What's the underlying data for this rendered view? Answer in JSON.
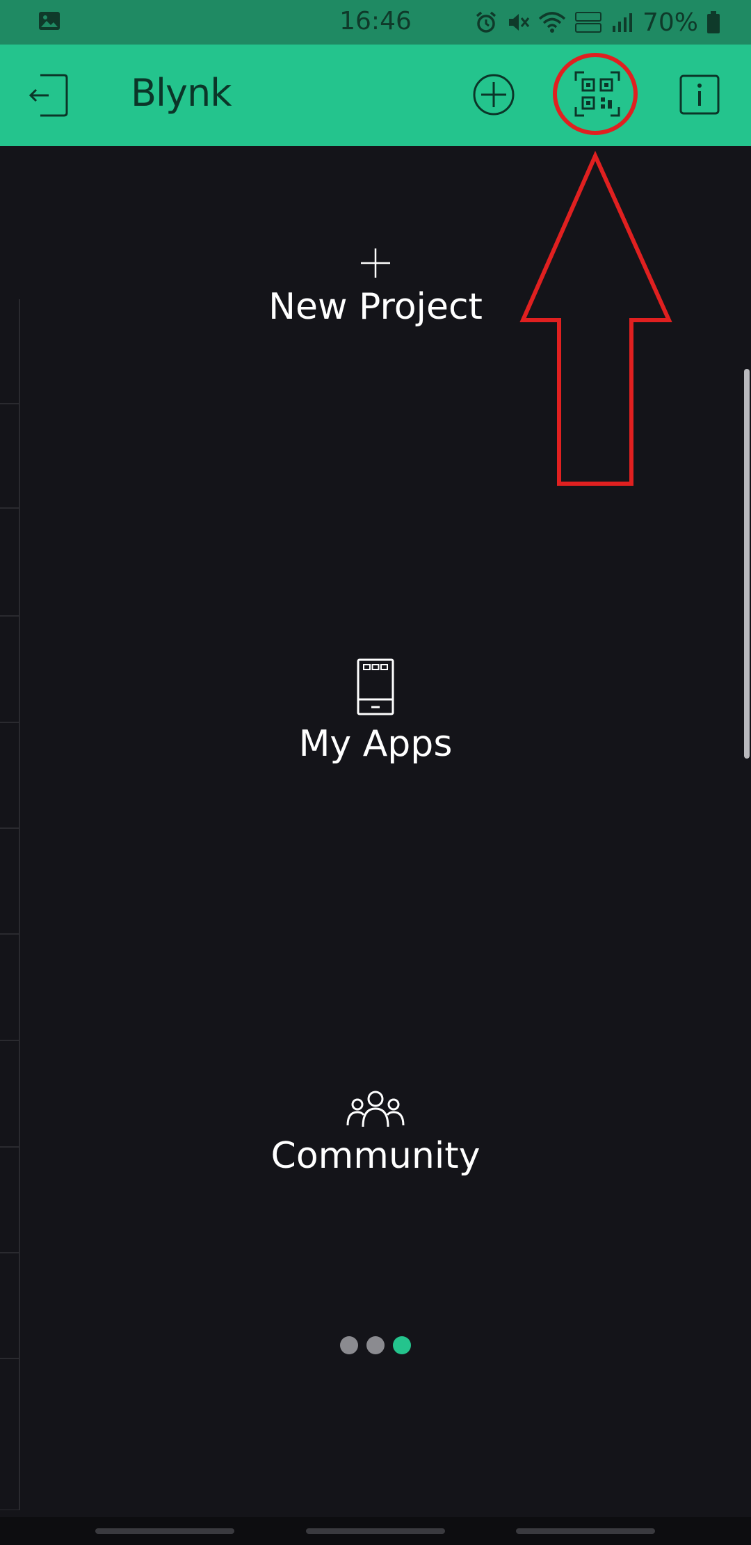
{
  "status_bar": {
    "time": "16:46",
    "battery_percent": "70%",
    "icons": [
      "gallery-icon",
      "alarm-icon",
      "mute-icon",
      "wifi-icon",
      "volte-icon",
      "signal-icon",
      "battery-icon"
    ]
  },
  "app_bar": {
    "title": "Blynk",
    "background": "#24c48d",
    "actions": [
      "logout-icon",
      "add-icon",
      "qr-code-icon",
      "info-icon"
    ]
  },
  "menu": {
    "new_project": {
      "label": "New Project",
      "icon": "plus-icon"
    },
    "my_apps": {
      "label": "My Apps",
      "icon": "phone-icon"
    },
    "community": {
      "label": "Community",
      "icon": "people-icon"
    }
  },
  "pager": {
    "count": 3,
    "active": 3
  },
  "colors": {
    "accent": "#24c48d",
    "background": "#141419",
    "annotation": "#e02020"
  }
}
